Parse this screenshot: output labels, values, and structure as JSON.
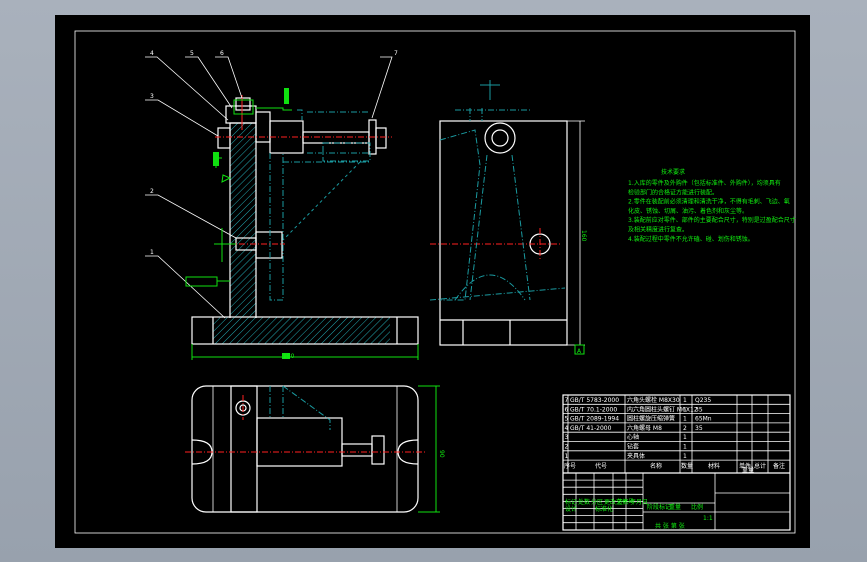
{
  "balloons": [
    "1",
    "2",
    "3",
    "4",
    "5",
    "6",
    "7"
  ],
  "technical_requirements": {
    "title": "技术要求",
    "lines": [
      "1.入库的零件及外购件（包括标准件、外购件），均须具有",
      "检验部门的合格证方能进行装配。",
      "2.零件在装配前必须清理和清洗干净，不得有毛刺、飞边、氧",
      "化皮、锈蚀、切屑、油污、着色剂和灰尘等。",
      "3.装配前应对零件、部件的主要配合尺寸，特别是过盈配合尺寸",
      "及相关精度进行复查。",
      "4.装配过程中零件不允许磕、碰、划伤和锈蚀。"
    ]
  },
  "dimensions": {
    "base_width": "180",
    "height_right": "160",
    "top_view_depth": "90",
    "datum": "A"
  },
  "parts_list": {
    "rows": [
      {
        "no": "7",
        "code": "GB/T 5783-2000",
        "name": "六角头螺栓 M8X30",
        "qty": "1",
        "material": "Q235"
      },
      {
        "no": "6",
        "code": "GB/T 70.1-2000",
        "name": "内六角圆柱头螺钉 M6X12",
        "qty": "1",
        "material": "35"
      },
      {
        "no": "5",
        "code": "GB/T 2089-1994",
        "name": "圆柱螺旋压缩弹簧",
        "qty": "1",
        "material": "65Mn"
      },
      {
        "no": "4",
        "code": "GB/T 41-2000",
        "name": "六角螺母 M8",
        "qty": "2",
        "material": "35"
      },
      {
        "no": "3",
        "code": "",
        "name": "心轴",
        "qty": "1",
        "material": ""
      },
      {
        "no": "2",
        "code": "",
        "name": "钻套",
        "qty": "1",
        "material": ""
      },
      {
        "no": "1",
        "code": "",
        "name": "夹具体",
        "qty": "1",
        "material": ""
      }
    ],
    "header": {
      "no": "序号",
      "code": "代号",
      "name": "名称",
      "qty": "数量",
      "material": "材料",
      "unit": "单件",
      "total": "总计",
      "weight": "重量",
      "remark": "备注"
    }
  },
  "title_block": {
    "labels": [
      "标记",
      "处数",
      "分区",
      "更改文件号",
      "签名",
      "年月日"
    ],
    "labels2": [
      "设计",
      "标准化"
    ],
    "stage_labels": [
      "阶段标记",
      "重量",
      "比例"
    ],
    "scale": "1:1",
    "sheet_label": "共  张  第  张"
  },
  "colors": {
    "sheet": "#000000",
    "line": "#ffffff",
    "hidden": "#1a9aa0",
    "center": "#ff2020",
    "annotation": "#10e010"
  }
}
